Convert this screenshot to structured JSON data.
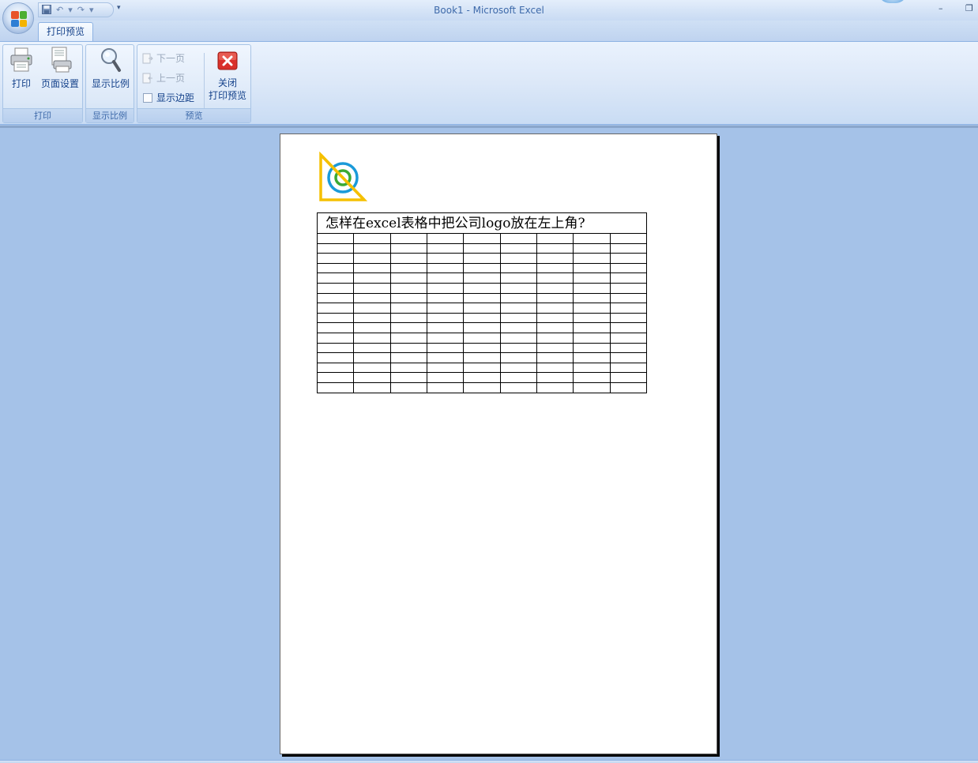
{
  "window": {
    "title": "Book1 - Microsoft Excel",
    "minimize_glyph": "–",
    "restore_glyph": "❐"
  },
  "quick_access": {
    "icons": [
      "save-icon",
      "undo-icon",
      "redo-icon",
      "customize-icon"
    ]
  },
  "tabs": [
    {
      "label": "打印预览",
      "active": true
    }
  ],
  "ribbon": {
    "groups": [
      {
        "label": "打印",
        "buttons": [
          {
            "label": "打印",
            "icon": "printer-icon",
            "enabled": true
          },
          {
            "label": "页面设置",
            "icon": "page-setup-icon",
            "enabled": true
          }
        ]
      },
      {
        "label": "显示比例",
        "buttons": [
          {
            "label": "显示比例",
            "icon": "zoom-icon",
            "enabled": true
          }
        ]
      },
      {
        "label": "预览",
        "buttons": [
          {
            "label": "下一页",
            "icon": "next-page-icon",
            "enabled": false
          },
          {
            "label": "上一页",
            "icon": "previous-page-icon",
            "enabled": false
          },
          {
            "label": "显示边距",
            "icon": "checkbox-icon",
            "enabled": true,
            "checked": false
          },
          {
            "label_line1": "关闭",
            "label_line2": "打印预览",
            "icon": "close-red-icon",
            "enabled": true
          }
        ]
      }
    ]
  },
  "preview": {
    "sheet_title": "怎样在excel表格中把公司logo放在左上角?",
    "grid_columns": 9,
    "grid_rows": 16,
    "logo_icon": "company-logo"
  },
  "colors": {
    "workspace": "#a5c2e8",
    "ribbon_text": "#15428b",
    "close_red": "#d9302a",
    "logo_yellow": "#f5c000",
    "logo_blue": "#1a9ad9",
    "logo_green": "#3aaa35"
  }
}
